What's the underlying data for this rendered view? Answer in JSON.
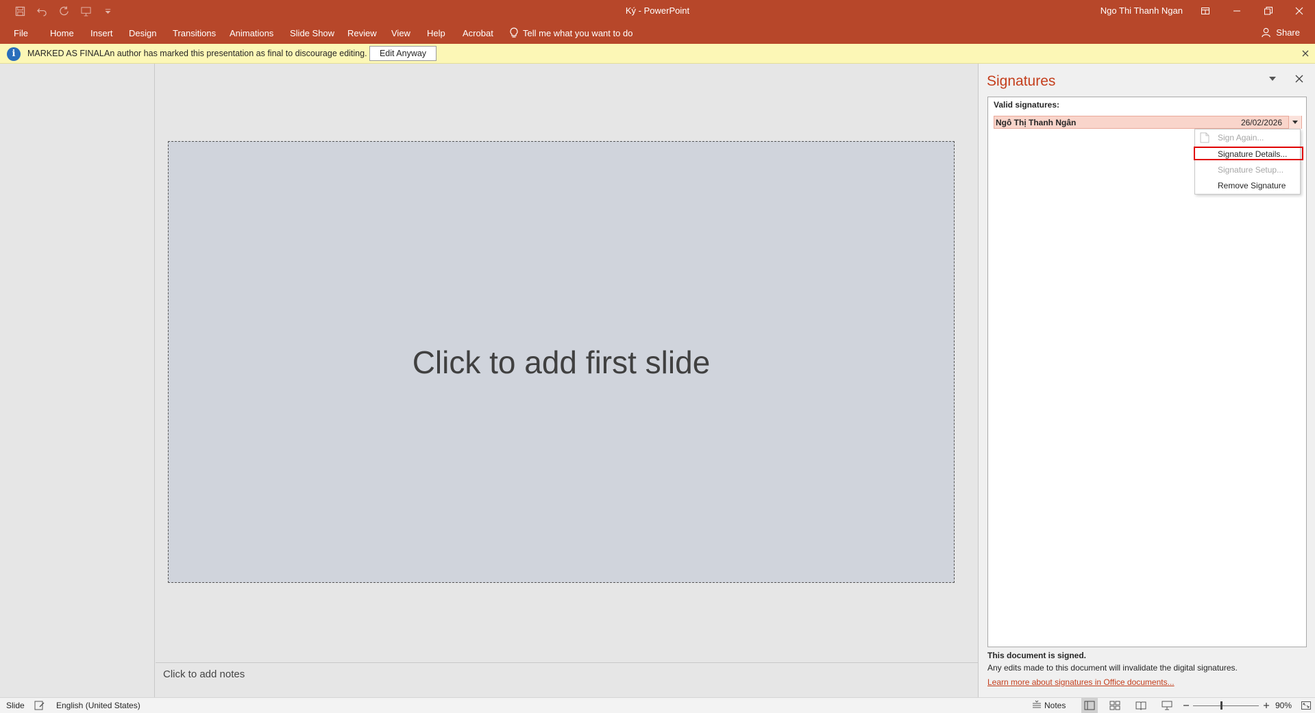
{
  "window": {
    "title": "Ký  -  PowerPoint",
    "user": "Ngo Thi Thanh Ngan",
    "accent": "#b7472a"
  },
  "quick_access": [
    "save-icon",
    "undo-icon",
    "redo-icon",
    "from-beginning-icon",
    "customize-icon"
  ],
  "ribbon": {
    "tabs": [
      "File",
      "Home",
      "Insert",
      "Design",
      "Transitions",
      "Animations",
      "Slide Show",
      "Review",
      "View",
      "Help",
      "Acrobat"
    ],
    "tell_me": "Tell me what you want to do",
    "share": "Share"
  },
  "message_bar": {
    "label": "MARKED AS FINAL",
    "text": "An author has marked this presentation as final to discourage editing.",
    "button": "Edit Anyway",
    "bg": "#fcf7b6"
  },
  "slide": {
    "placeholder": "Click to add first slide"
  },
  "notes": {
    "placeholder": "Click to add notes"
  },
  "signatures_pane": {
    "title": "Signatures",
    "valid_heading": "Valid signatures:",
    "signature": {
      "name": "Ngô Thị Thanh Ngân",
      "date": "26/02/2026"
    },
    "menu": {
      "sign_again": "Sign Again...",
      "details": "Signature Details...",
      "setup": "Signature Setup...",
      "remove": "Remove Signature"
    },
    "footer_bold": "This document is signed.",
    "footer_text": "Any edits made to this document will invalidate the digital signatures.",
    "footer_link": "Learn more about signatures in Office documents..."
  },
  "status": {
    "slide": "Slide",
    "language": "English (United States)",
    "notes": "Notes",
    "zoom": "90%"
  }
}
